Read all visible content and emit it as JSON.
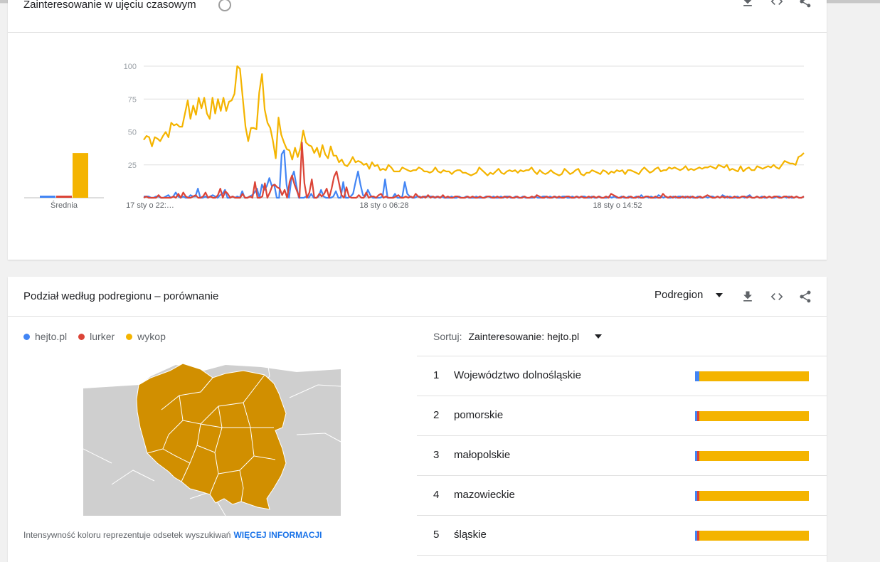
{
  "colors": {
    "hejto": "#4285f4",
    "lurker": "#db4437",
    "wykop": "#f4b400",
    "map_fill": "#d18f00"
  },
  "card1": {
    "title": "Zainteresowanie w ujęciu czasowym",
    "avg_label": "Średnia"
  },
  "chart_data": {
    "type": "line",
    "title": "Zainteresowanie w ujęciu czasowym",
    "xlabel": "",
    "ylabel": "",
    "ylim": [
      0,
      100
    ],
    "yticks": [
      "25",
      "50",
      "75",
      "100"
    ],
    "xticks": [
      "17 sty o 22:…",
      "18 sty o 06:28",
      "18 sty o 14:52"
    ],
    "averages": {
      "hejto.pl": 1,
      "lurker": 1,
      "wykop": 34
    },
    "series": [
      {
        "name": "wykop",
        "color": "#f4b400",
        "values": [
          44,
          47,
          46,
          39,
          46,
          45,
          43,
          47,
          50,
          46,
          57,
          55,
          56,
          54,
          54,
          64,
          74,
          60,
          70,
          63,
          76,
          68,
          76,
          64,
          60,
          76,
          64,
          75,
          66,
          76,
          66,
          73,
          74,
          79,
          100,
          98,
          76,
          54,
          43,
          53,
          53,
          52,
          80,
          94,
          67,
          57,
          53,
          43,
          30,
          61,
          48,
          42,
          37,
          36,
          29,
          38,
          31,
          38,
          51,
          42,
          40,
          39,
          34,
          38,
          31,
          40,
          33,
          30,
          39,
          32,
          32,
          27,
          29,
          25,
          24,
          27,
          31,
          27,
          28,
          27,
          25,
          26,
          22,
          27,
          24,
          25,
          21,
          22,
          21,
          25,
          23,
          20,
          20,
          20,
          23,
          22,
          21,
          20,
          21,
          21,
          23,
          22,
          20,
          20,
          19,
          20,
          23,
          20,
          19,
          21,
          20,
          20,
          18,
          20,
          21,
          21,
          19,
          19,
          18,
          17,
          18,
          19,
          23,
          21,
          19,
          17,
          19,
          18,
          20,
          22,
          19,
          18,
          20,
          21,
          20,
          21,
          19,
          21,
          20,
          21,
          21,
          23,
          20,
          18,
          21,
          19,
          18,
          19,
          21,
          19,
          18,
          17,
          18,
          22,
          20,
          18,
          19,
          21,
          22,
          18,
          17,
          19,
          19,
          21,
          20,
          19,
          18,
          21,
          20,
          18,
          20,
          19,
          21,
          20,
          21,
          18,
          21,
          21,
          20,
          19,
          18,
          21,
          23,
          21,
          19,
          20,
          22,
          23,
          20,
          21,
          21,
          23,
          22,
          23,
          22,
          21,
          22,
          24,
          21,
          22,
          21,
          22,
          23,
          22,
          23,
          23,
          24,
          23,
          22,
          25,
          24,
          23,
          25,
          21,
          22,
          21,
          20,
          24,
          20,
          22,
          23,
          21,
          21,
          24,
          23,
          22,
          23,
          24,
          23,
          25,
          23,
          22,
          25,
          28,
          27,
          26,
          26,
          25,
          31,
          32,
          34
        ]
      },
      {
        "name": "hejto.pl",
        "color": "#4285f4",
        "values": [
          1,
          1,
          1,
          0,
          0,
          1,
          1,
          0,
          0,
          1,
          2,
          0,
          1,
          4,
          1,
          0,
          1,
          0,
          0,
          2,
          1,
          1,
          7,
          0,
          0,
          1,
          0,
          1,
          2,
          1,
          0,
          2,
          3,
          6,
          0,
          0,
          1,
          0,
          1,
          0,
          5,
          0,
          0,
          1,
          2,
          4,
          7,
          0,
          10,
          6,
          9,
          15,
          9,
          10,
          0,
          0,
          33,
          36,
          10,
          0,
          15,
          20,
          9,
          0,
          0,
          0,
          1,
          0,
          3,
          0,
          0,
          1,
          6,
          1,
          0,
          0,
          0,
          1,
          5,
          0,
          0,
          12,
          0,
          0,
          1,
          3,
          12,
          20,
          10,
          2,
          1,
          6,
          2,
          0,
          0,
          0,
          0,
          1,
          14,
          0,
          0,
          0,
          3,
          0,
          0,
          1,
          12,
          3,
          1,
          0,
          0,
          1,
          1,
          0,
          1,
          1,
          1,
          1,
          0,
          1,
          0,
          1,
          0,
          0,
          0,
          1,
          0,
          0,
          1,
          0,
          0,
          1,
          0,
          0,
          0,
          1,
          0,
          0,
          0,
          1,
          1,
          0,
          1,
          0,
          0,
          1,
          0,
          1,
          1,
          0,
          0,
          1,
          0,
          0,
          1,
          0,
          0,
          0,
          0,
          1,
          0,
          0,
          1,
          1,
          0,
          1,
          0,
          1,
          0,
          0,
          1,
          1,
          0,
          0,
          1,
          0,
          1,
          0,
          1,
          1,
          0,
          0,
          1,
          0,
          0,
          1,
          0,
          0,
          0,
          1,
          0,
          1,
          0,
          0,
          1,
          0,
          0,
          1,
          0,
          0,
          1,
          0,
          2,
          0,
          1,
          0,
          1,
          0,
          0,
          2,
          1,
          0,
          1,
          0,
          0,
          1,
          0,
          1,
          1,
          0,
          1,
          0,
          1,
          0,
          0,
          1,
          0,
          0,
          1,
          0,
          1,
          1,
          0,
          1,
          0,
          2,
          1,
          0,
          1,
          0,
          0,
          1,
          0,
          1,
          0,
          1,
          2,
          0,
          0,
          1,
          0,
          1,
          0,
          0,
          1,
          0,
          0,
          1,
          1,
          0,
          1,
          0,
          1,
          0,
          0,
          1,
          0,
          0,
          1
        ]
      },
      {
        "name": "lurker",
        "color": "#db4437",
        "values": [
          0,
          1,
          0,
          0,
          0,
          0,
          2,
          0,
          0,
          0,
          0,
          0,
          1,
          0,
          3,
          0,
          4,
          1,
          0,
          0,
          1,
          2,
          0,
          0,
          1,
          4,
          0,
          1,
          0,
          0,
          2,
          7,
          0,
          5,
          3,
          0,
          1,
          0,
          0,
          0,
          3,
          0,
          0,
          1,
          0,
          12,
          0,
          0,
          1,
          11,
          0,
          4,
          9,
          10,
          8,
          7,
          2,
          6,
          0,
          12,
          17,
          10,
          5,
          0,
          42,
          11,
          0,
          4,
          14,
          0,
          0,
          3,
          1,
          3,
          7,
          0,
          7,
          16,
          20,
          11,
          2,
          0,
          8,
          1,
          0,
          0,
          0,
          2,
          0,
          0,
          4,
          0,
          1,
          1,
          0,
          2,
          3,
          0,
          1,
          0,
          0,
          0,
          1,
          2,
          0,
          0,
          1,
          0,
          1,
          0,
          3,
          1,
          0,
          1,
          0,
          2,
          0,
          1,
          0,
          1,
          0,
          2,
          0,
          1,
          0,
          0,
          1,
          1,
          0,
          0,
          0,
          1,
          0,
          1,
          0,
          0,
          1,
          0,
          0,
          1,
          1,
          0,
          0,
          1,
          0,
          0,
          1,
          0,
          1,
          0,
          0,
          1,
          0,
          0,
          1,
          0,
          0,
          1,
          0,
          2,
          1,
          0,
          0,
          1,
          0,
          0,
          1,
          0,
          1,
          0,
          0,
          1,
          1,
          0,
          0,
          1,
          0,
          1,
          0,
          0,
          1,
          0,
          1,
          0,
          1,
          0,
          0,
          1,
          0,
          3,
          2,
          1,
          0,
          0,
          1,
          0,
          0,
          1,
          0,
          0,
          1,
          0,
          0,
          1,
          1,
          0,
          0,
          1,
          0,
          0,
          3,
          1,
          0,
          1,
          0,
          1,
          0,
          0,
          1,
          0,
          1,
          0,
          1,
          0,
          0,
          1,
          0,
          1,
          2,
          1,
          0,
          0,
          1,
          0,
          1,
          0,
          1,
          0,
          0,
          1,
          0,
          0,
          1,
          1,
          0,
          1,
          0,
          0,
          1,
          0,
          0,
          1,
          0,
          1,
          0,
          1,
          1,
          0,
          0,
          1,
          1,
          0,
          1,
          0,
          1,
          0,
          0,
          1
        ]
      }
    ]
  },
  "card2": {
    "title": "Podział według podregionu – porównanie",
    "region_select": "Podregion",
    "legend": [
      "hejto.pl",
      "lurker",
      "wykop"
    ],
    "sort_label": "Sortuj:",
    "sort_value": "Zainteresowanie: hejto.pl",
    "footnote": "Intensywność koloru reprezentuje odsetek wyszukiwań",
    "more_info": "WIĘCEJ INFORMACJI",
    "regions": [
      {
        "rank": "1",
        "name": "Województwo dolnośląskie",
        "shares": [
          4,
          0,
          96
        ]
      },
      {
        "rank": "2",
        "name": "pomorskie",
        "shares": [
          2,
          1,
          97
        ]
      },
      {
        "rank": "3",
        "name": "małopolskie",
        "shares": [
          2,
          1,
          97
        ]
      },
      {
        "rank": "4",
        "name": "mazowieckie",
        "shares": [
          1,
          1,
          98
        ]
      },
      {
        "rank": "5",
        "name": "śląskie",
        "shares": [
          1,
          1,
          98
        ]
      }
    ]
  }
}
